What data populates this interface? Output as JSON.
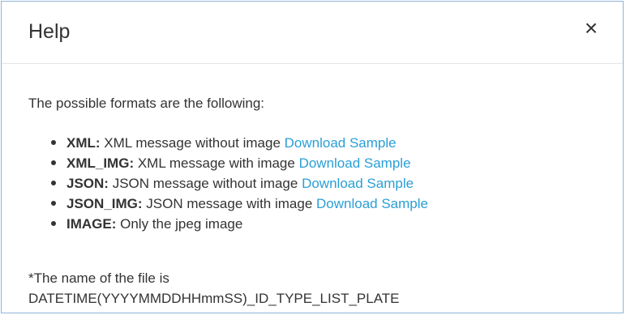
{
  "dialog": {
    "title": "Help",
    "close_icon": "close-icon",
    "close_glyph": "×",
    "intro": "The possible formats are the following:",
    "formats": [
      {
        "name": "XML:",
        "description": " XML message without image ",
        "link": "Download Sample"
      },
      {
        "name": "XML_IMG:",
        "description": " XML message with image ",
        "link": "Download Sample"
      },
      {
        "name": "JSON:",
        "description": " JSON message without image ",
        "link": "Download Sample"
      },
      {
        "name": "JSON_IMG:",
        "description": " JSON message with image ",
        "link": "Download Sample"
      },
      {
        "name": "IMAGE:",
        "description": " Only the jpeg image",
        "link": ""
      }
    ],
    "note_line1": "*The name of the file is",
    "note_line2": "DATETIME(YYYYMMDDHHmmSS)_ID_TYPE_LIST_PLATE"
  },
  "colors": {
    "link": "#2a9fd6",
    "border": "#8fb3d9",
    "text": "#333333"
  }
}
